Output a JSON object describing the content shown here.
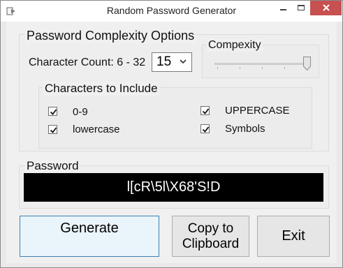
{
  "window": {
    "title": "Random Password Generator",
    "minimize_label": "−",
    "maximize_label": "□",
    "close_label": "✕"
  },
  "complexity_group": {
    "title": "Password Complexity Options",
    "char_count_label": "Character Count: 6 - 32",
    "char_count_value": "15",
    "complexity_label": "Compexity",
    "complexity_level": 1.0
  },
  "chars_group": {
    "title": "Characters to Include",
    "options": [
      {
        "label": "0-9",
        "checked": true
      },
      {
        "label": "lowercase",
        "checked": true
      },
      {
        "label": "UPPERCASE",
        "checked": true
      },
      {
        "label": "Symbols",
        "checked": true
      }
    ]
  },
  "password_group": {
    "title": "Password",
    "value": "l[cR\\5l\\X68'S!D"
  },
  "buttons": {
    "generate": "Generate",
    "copy_line1": "Copy to",
    "copy_line2": "Clipboard",
    "exit": "Exit"
  },
  "colors": {
    "close_button": "#c75050",
    "password_bg": "#000000",
    "password_fg": "#ffffff",
    "primary_border": "#3c7fb1"
  }
}
